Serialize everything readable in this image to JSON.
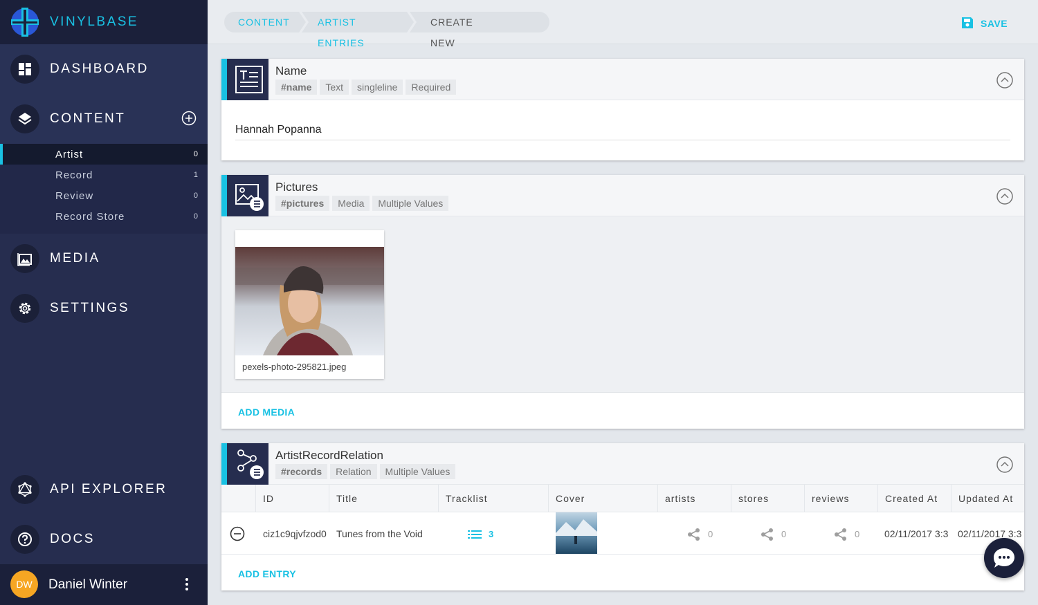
{
  "app": {
    "title": "VINYLBASE"
  },
  "nav": {
    "dashboard": "DASHBOARD",
    "content": "CONTENT",
    "media": "MEDIA",
    "settings": "SETTINGS",
    "api_explorer": "API EXPLORER",
    "docs": "DOCS"
  },
  "content_models": [
    {
      "label": "Artist",
      "count": "0",
      "active": true
    },
    {
      "label": "Record",
      "count": "1",
      "active": false
    },
    {
      "label": "Review",
      "count": "0",
      "active": false
    },
    {
      "label": "Record Store",
      "count": "0",
      "active": false
    }
  ],
  "user": {
    "initials": "DW",
    "name": "Daniel Winter"
  },
  "breadcrumb": [
    "CONTENT",
    "ARTIST ENTRIES",
    "CREATE NEW ARTIST"
  ],
  "toolbar": {
    "save_label": "SAVE"
  },
  "fields": {
    "name": {
      "title": "Name",
      "tags": [
        "#name",
        "Text",
        "singleline",
        "Required"
      ],
      "value": "Hannah Popanna"
    },
    "pictures": {
      "title": "Pictures",
      "tags": [
        "#pictures",
        "Media",
        "Multiple Values"
      ],
      "media": [
        {
          "filename": "pexels-photo-295821.jpeg"
        }
      ],
      "add_label": "ADD MEDIA"
    },
    "relation": {
      "title": "ArtistRecordRelation",
      "tags": [
        "#records",
        "Relation",
        "Multiple Values"
      ],
      "columns": [
        "ID",
        "Title",
        "Tracklist",
        "Cover",
        "artists",
        "stores",
        "reviews",
        "Created At",
        "Updated At"
      ],
      "rows": [
        {
          "id": "ciz1c9qjvfzod0",
          "title": "Tunes from the Void",
          "tracklist": "3",
          "artists": "0",
          "stores": "0",
          "reviews": "0",
          "created_at": "02/11/2017 3:3",
          "updated_at": "02/11/2017 3:3"
        }
      ],
      "add_label": "ADD ENTRY"
    }
  },
  "colors": {
    "accent": "#19c1e3",
    "sidebar": "#262d4f",
    "avatar": "#f6a623"
  }
}
